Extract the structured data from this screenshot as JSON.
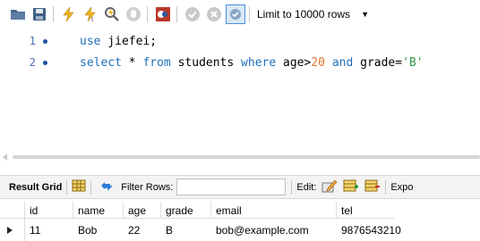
{
  "toolbar": {
    "limit_label": "Limit to 10000 rows",
    "icons": [
      "open-folder-icon",
      "save-icon",
      "execute-icon",
      "execute-current-icon",
      "explain-icon",
      "stop-icon",
      "toggle-output-icon",
      "commit-icon",
      "rollback-icon",
      "autocommit-icon"
    ]
  },
  "editor": {
    "line1_no": "1",
    "line2_no": "2",
    "line1": {
      "kw": "use",
      "rest": " jiefei;"
    },
    "line2": {
      "kw1": "select",
      "t1": " * ",
      "kw2": "from",
      "t2": " students ",
      "kw3": "where",
      "t3": " age>",
      "num": "20",
      "t4": " ",
      "kw4": "and",
      "t5": " grade=",
      "str": "'B'"
    }
  },
  "result": {
    "grid_label": "Result Grid",
    "filter_label": "Filter Rows:",
    "edit_label": "Edit:",
    "export_label": "Expo"
  },
  "grid": {
    "columns": [
      "id",
      "name",
      "age",
      "grade",
      "email",
      "tel"
    ],
    "rows": [
      [
        "11",
        "Bob",
        "22",
        "B",
        "bob@example.com",
        "9876543210"
      ]
    ]
  },
  "colors": {
    "keyword": "#1f6fb8",
    "number": "#e1722b",
    "string": "#2e9a43"
  }
}
